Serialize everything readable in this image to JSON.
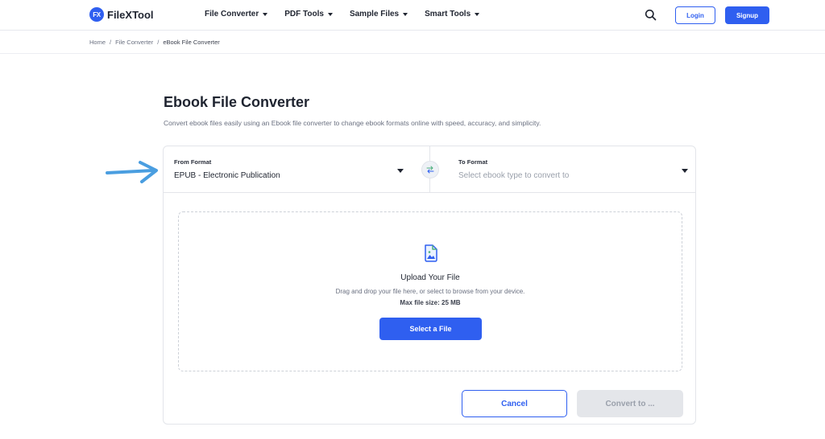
{
  "brand": {
    "logo_mark": "FX",
    "name": "FileXTool",
    "accent": "#2f5ff0"
  },
  "nav": {
    "items": [
      {
        "label": "File Converter"
      },
      {
        "label": "PDF Tools"
      },
      {
        "label": "Sample Files"
      },
      {
        "label": "Smart Tools"
      }
    ],
    "search_icon": "search-icon",
    "login": "Login",
    "signup": "Signup"
  },
  "breadcrumb": {
    "items": [
      "Home",
      "File Converter",
      "eBook File Converter"
    ],
    "separator": "/"
  },
  "page": {
    "title": "Ebook File Converter",
    "description": "Convert ebook files easily using an Ebook file converter to change ebook formats online with speed, accuracy, and simplicity."
  },
  "converter": {
    "from": {
      "label": "From Format",
      "value": "EPUB - Electronic Publication"
    },
    "to": {
      "label": "To Format",
      "placeholder": "Select ebook type to convert to"
    },
    "swap_icon": "swap-icon"
  },
  "upload": {
    "icon": "image-file-icon",
    "title": "Upload Your File",
    "hint": "Drag and drop your file here, or select to browse from your device.",
    "max_size": "Max file size: 25 MB",
    "select_button": "Select a File"
  },
  "actions": {
    "cancel": "Cancel",
    "convert": "Convert to ...",
    "convert_enabled": false
  },
  "annotation": {
    "icon": "pointer-arrow-icon",
    "color": "#4a9ee0"
  }
}
